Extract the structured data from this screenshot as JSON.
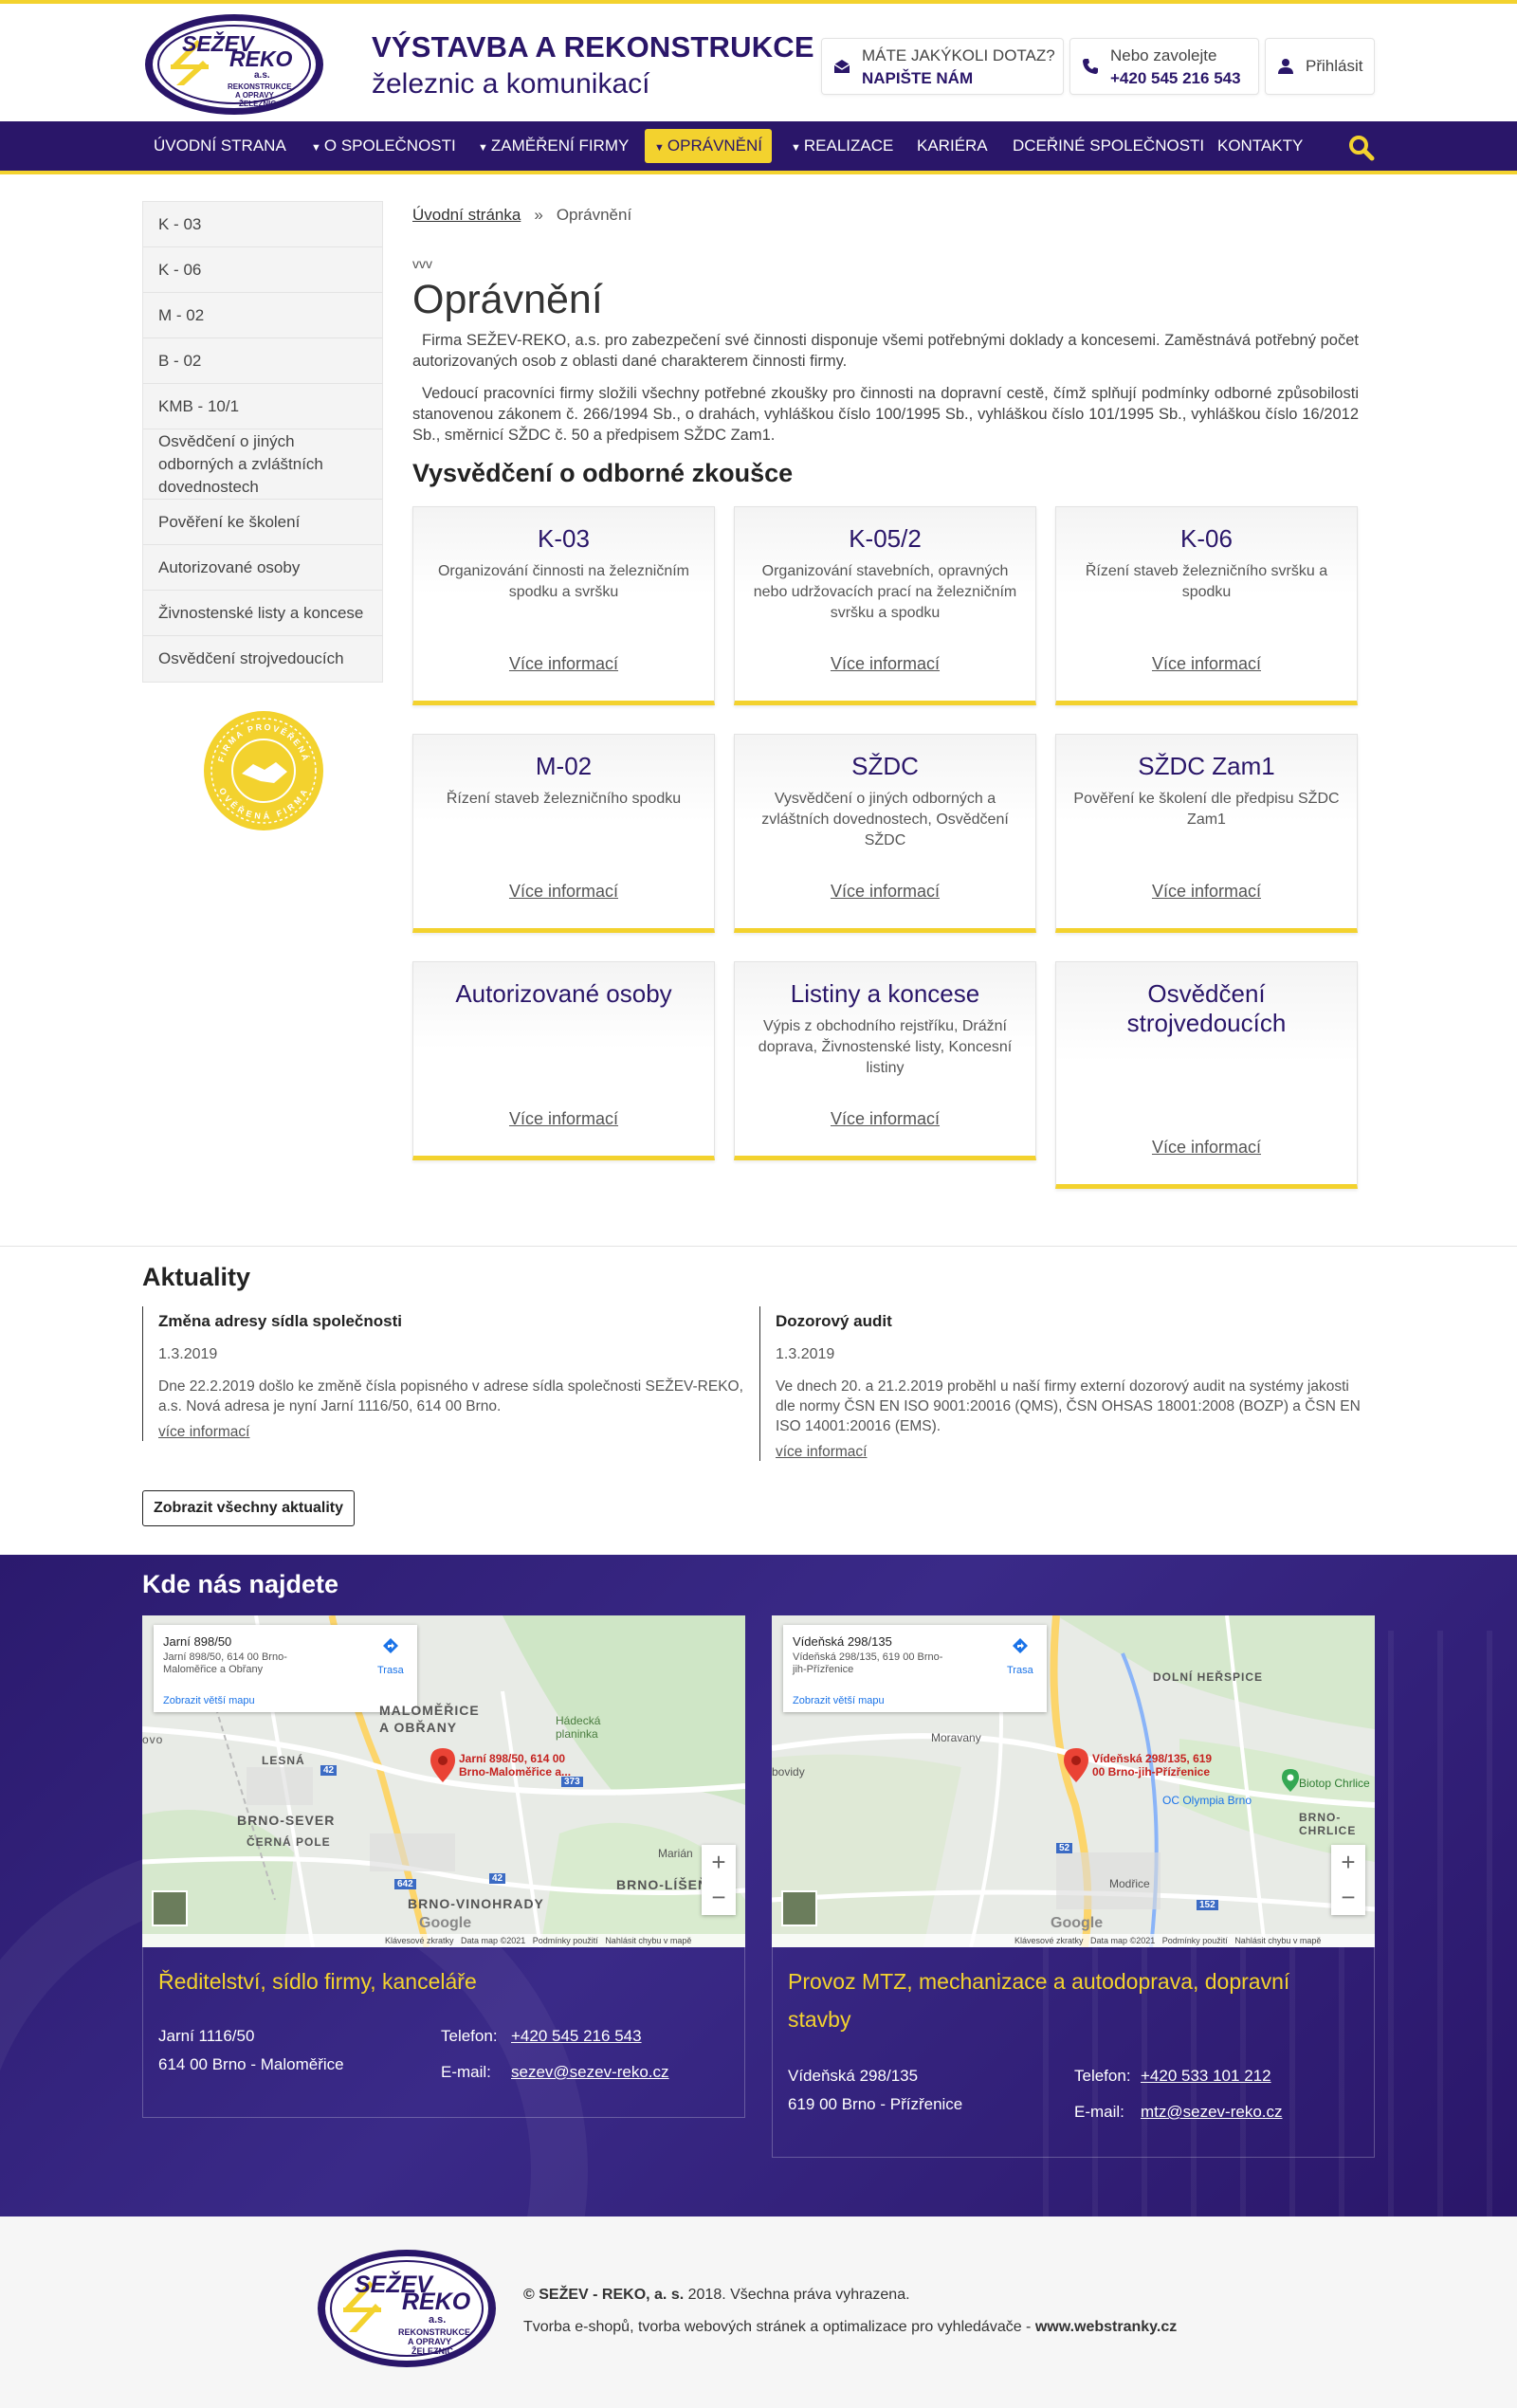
{
  "header": {
    "logo": {
      "line1": "SEŽEV",
      "line2": "REKO",
      "line3": "a.s.",
      "line4": "REKONSTRUKCE",
      "line5": "A OPRAVY",
      "line6": "ŽELEZNIC"
    },
    "title": "VÝSTAVBA A REKONSTRUKCE",
    "subtitle": "železnic a komunikací",
    "contact_question": "MÁTE JAKÝKOLI DOTAZ?",
    "contact_write": "NAPIŠTE NÁM",
    "call_label": "Nebo zavolejte",
    "call_number": "+420 545 216 543",
    "login": "Přihlásit"
  },
  "nav": {
    "items": [
      {
        "label": "ÚVODNÍ STRANA",
        "caret": false
      },
      {
        "label": "O SPOLEČNOSTI",
        "caret": true
      },
      {
        "label": "ZAMĚŘENÍ FIRMY",
        "caret": true
      },
      {
        "label": "OPRÁVNĚNÍ",
        "caret": true,
        "active": true
      },
      {
        "label": "REALIZACE",
        "caret": true
      },
      {
        "label": "KARIÉRA",
        "caret": false
      },
      {
        "label": "DCEŘINÉ SPOLEČNOSTI",
        "caret": false
      },
      {
        "label": "KONTAKTY",
        "caret": false
      }
    ],
    "search_icon": "search-icon"
  },
  "sidebar": {
    "items": [
      "K - 03",
      "K - 06",
      "M - 02",
      "B - 02",
      "KMB - 10/1",
      "Osvědčení o jiných odborných a zvláštních dovednostech",
      "Pověření ke školení",
      "Autorizované osoby",
      "Živnostenské listy a koncese",
      "Osvědčení strojvedoucích"
    ],
    "badge": {
      "top": "FIRMA PROVĚŘENÁ",
      "bottom": "OVĚŘENÁ FIRMA"
    }
  },
  "breadcrumb": {
    "home": "Úvodní stránka",
    "sep": "»",
    "current": "Oprávnění"
  },
  "main": {
    "pre": "vvv",
    "title": "Oprávnění",
    "para1": "Firma SEŽEV-REKO, a.s. pro zabezpečení své činnosti disponuje všemi potřebnými doklady a koncesemi. Zaměstnává potřebný počet autorizovaných osob z oblasti dané charakterem činnosti firmy.",
    "para2": "Vedoucí pracovníci firmy složili všechny potřebné zkoušky pro činnosti na dopravní cestě, čímž splňují podmínky odborné způsobilosti stanovenou zákonem č. 266/1994 Sb., o drahách, vyhláškou číslo 100/1995 Sb., vyhláškou číslo 101/1995 Sb., vyhláškou číslo 16/2012 Sb., směrnicí SŽDC č. 50 a předpisem SŽDC Zam1.",
    "section_title": "Vysvědčení o odborné zkoušce",
    "more_label": "Více informací",
    "cards": [
      {
        "title": "K-03",
        "desc": "Organizování činnosti na železničním spodku a svršku"
      },
      {
        "title": "K-05/2",
        "desc": "Organizování stavebních, opravných nebo udržovacích prací na železničním svršku a spodku"
      },
      {
        "title": "K-06",
        "desc": "Řízení staveb železničního svršku a spodku"
      },
      {
        "title": "M-02",
        "desc": "Řízení staveb železničního spodku"
      },
      {
        "title": "SŽDC",
        "desc": "Vysvědčení o jiných odborných a zvláštních dovednostech, Osvědčení SŽDC"
      },
      {
        "title": "SŽDC Zam1",
        "desc": "Pověření ke školení dle předpisu SŽDC Zam1"
      },
      {
        "title": "Autorizované osoby",
        "desc": ""
      },
      {
        "title": "Listiny a koncese",
        "desc": "Výpis z obchodního rejstříku, Drážní doprava, Živnostenské listy, Koncesní listiny"
      },
      {
        "title": "Osvědčení strojvedoucích",
        "desc": ""
      }
    ]
  },
  "news": {
    "title": "Aktuality",
    "more_label": "více informací",
    "items": [
      {
        "title": "Změna adresy sídla společnosti",
        "date": "1.3.2019",
        "text": "Dne 22.2.2019 došlo ke změně čísla popisného v adrese sídla společnosti SEŽEV-REKO, a.s. Nová adresa je nyní Jarní 1116/50, 614 00 Brno."
      },
      {
        "title": "Dozorový audit",
        "date": "1.3.2019",
        "text": "Ve dnech 20. a 21.2.2019 proběhl u naší firmy externí dozorový audit na systémy jakosti dle normy ČSN EN ISO 9001:20016 (QMS), ČSN OHSAS 18001:2008 (BOZP) a ČSN EN ISO 14001:20016 (EMS)."
      }
    ],
    "all_button": "Zobrazit všechny aktuality"
  },
  "find": {
    "title": "Kde nás najdete",
    "maps": [
      {
        "card_title": "Jarní 898/50",
        "card_address": "Jarní 898/50, 614 00 Brno-Maloměřice a Obřany",
        "card_zoom": "Zobrazit větší mapu",
        "route": "Trasa",
        "pin_label": "Jarní 898/50, 614 00 Brno-Maloměřice a...",
        "areas": [
          "MALOMĚŘICE",
          "A OBŘANY",
          "Hádecká planinka",
          "LESNÁ",
          "BRNO-SEVER",
          "ČERNÁ POLE",
          "BRNO-VINOHRADY",
          "BRNO-LÍŠEŇ",
          "Marián",
          "ovo"
        ],
        "roads": [
          "42",
          "373",
          "642",
          "42"
        ],
        "google": "Google",
        "footer": [
          "Klávesové zkratky",
          "Data map ©2021",
          "Podmínky použití",
          "Nahlásit chybu v mapě"
        ]
      },
      {
        "card_title": "Vídeňská 298/135",
        "card_address": "Vídeňská 298/135, 619 00 Brno-jih-Přízřenice",
        "card_zoom": "Zobrazit větší mapu",
        "route": "Trasa",
        "pin_label": "Vídeňská 298/135, 619 00 Brno-jih-Přízřenice",
        "areas": [
          "DOLNÍ HEŘSPICE",
          "Moravany",
          "bovidy",
          "OC Olympia Brno",
          "Biotop Chrlice",
          "BRNO-CHRLICE",
          "Modřice"
        ],
        "roads": [
          "152",
          "52"
        ],
        "google": "Google",
        "footer": [
          "Klávesové zkratky",
          "Data map ©2021",
          "Podmínky použití",
          "Nahlásit chybu v mapě"
        ]
      }
    ],
    "offices": [
      {
        "title": "Ředitelství, sídlo firmy, kanceláře",
        "street": "Jarní 1116/50",
        "city": "614 00 Brno - Maloměřice",
        "phone_label": "Telefon:",
        "phone": "+420 545 216 543",
        "email_label": "E-mail:",
        "email": "sezev@sezev-reko.cz"
      },
      {
        "title": "Provoz MTZ, mechanizace a autodoprava, dopravní stavby",
        "street": "Vídeňská 298/135",
        "city": "619 00 Brno - Přízřenice",
        "phone_label": "Telefon:",
        "phone": "+420 533 101 212",
        "email_label": "E-mail:",
        "email": "mtz@sezev-reko.cz"
      }
    ]
  },
  "footer": {
    "copy_brand": "© SEŽEV - REKO, a. s.",
    "copy_rest": " 2018. Všechna práva vyhrazena.",
    "web_text": "Tvorba e-shopů, tvorba webových stránek a optimalizace pro vyhledávače - ",
    "web_link": "www.webstranky.cz"
  },
  "colors": {
    "brand": "#2a1669",
    "accent": "#f3d22e",
    "map_pin": "#ea4335"
  }
}
